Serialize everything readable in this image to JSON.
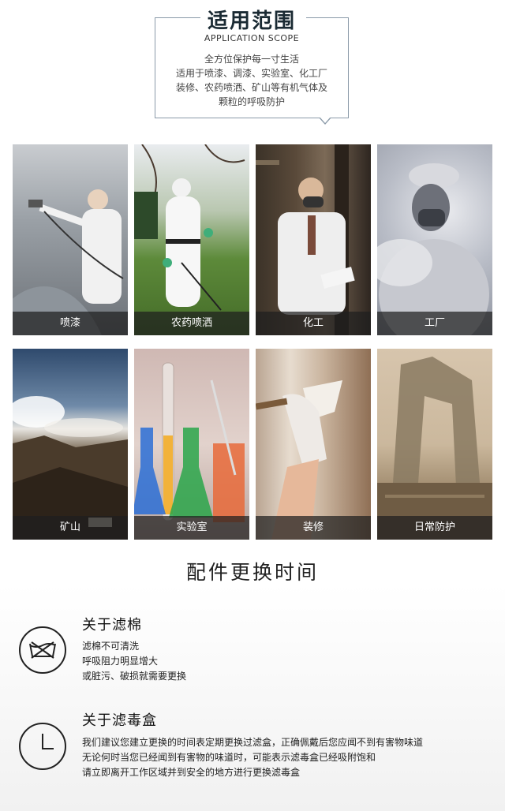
{
  "scope": {
    "title": "适用范围",
    "subtitle": "APPLICATION SCOPE",
    "lines": [
      "全方位保护每一寸生活",
      "适用于喷漆、调漆、实验室、化工厂",
      "装修、农药喷洒、矿山等有机气体及",
      "颗粒的呼吸防护"
    ]
  },
  "tiles": [
    {
      "label": "喷漆"
    },
    {
      "label": "农药喷洒"
    },
    {
      "label": "化工"
    },
    {
      "label": "工厂"
    },
    {
      "label": "矿山"
    },
    {
      "label": "实验室"
    },
    {
      "label": "装修"
    },
    {
      "label": "日常防护"
    }
  ],
  "replacement": {
    "title": "配件更换时间",
    "filter_cotton": {
      "title": "关于滤棉",
      "lines": [
        "滤棉不可清洗",
        "呼吸阻力明显增大",
        "或脏污、破损就需要更换"
      ],
      "icon": "no-wash-icon"
    },
    "filter_cartridge": {
      "title": "关于滤毒盒",
      "lines": [
        "我们建议您建立更换的时间表定期更换过滤盒，正确佩戴后您应闻不到有害物味道",
        "无论何时当您已经闻到有害物的味道时，可能表示滤毒盒已经吸附饱和",
        "请立即离开工作区域并到安全的地方进行更换滤毒盒"
      ],
      "icon": "clock-icon"
    }
  }
}
